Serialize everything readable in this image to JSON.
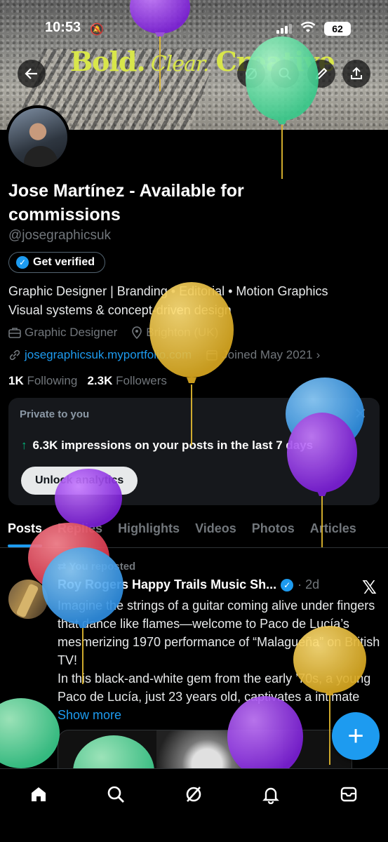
{
  "status_bar": {
    "time": "10:53",
    "battery": "62"
  },
  "banner": {
    "word1": "Bold.",
    "word2": "Clear.",
    "word3": "Creative"
  },
  "profile": {
    "name": "Jose Martínez - Available for commissions",
    "handle": "@josegraphicsuk",
    "get_verified": "Get verified",
    "bio_line1": "Graphic Designer | Branding • Editorial • Motion Graphics",
    "bio_line2": "Visual systems & concept-driven design",
    "category": "Graphic Designer",
    "location": "Brighton (UK)",
    "website": "josegraphicsuk.myportfolio.com",
    "joined": "Joined May 2021",
    "following_count": "1K",
    "following_label": "Following",
    "followers_count": "2.3K",
    "followers_label": "Followers"
  },
  "private_card": {
    "label": "Private to you",
    "impressions": "6.3K impressions on your posts in the last 7 days",
    "unlock": "Unlock analytics"
  },
  "tabs": [
    "Posts",
    "Replies",
    "Highlights",
    "Videos",
    "Photos",
    "Articles"
  ],
  "post": {
    "repost_label": "You reposted",
    "author": "Roy Rogers Happy Trails Music Sh...",
    "time": "· 2d",
    "text": "Imagine the strings of a guitar coming alive under fingers that dance like flames—welcome to Paco de Lucía’s mesmerizing 1970 performance of “Malagueña” on British TV!",
    "text2": "In this black-and-white gem from the early ’70s, a young Paco de Lucía, just 23 years old, captivates a intimate",
    "show_more": "Show more"
  },
  "colors": {
    "accent": "#1d9bf0",
    "background": "#000000",
    "card": "#16181c",
    "green": "#00ba7c"
  }
}
